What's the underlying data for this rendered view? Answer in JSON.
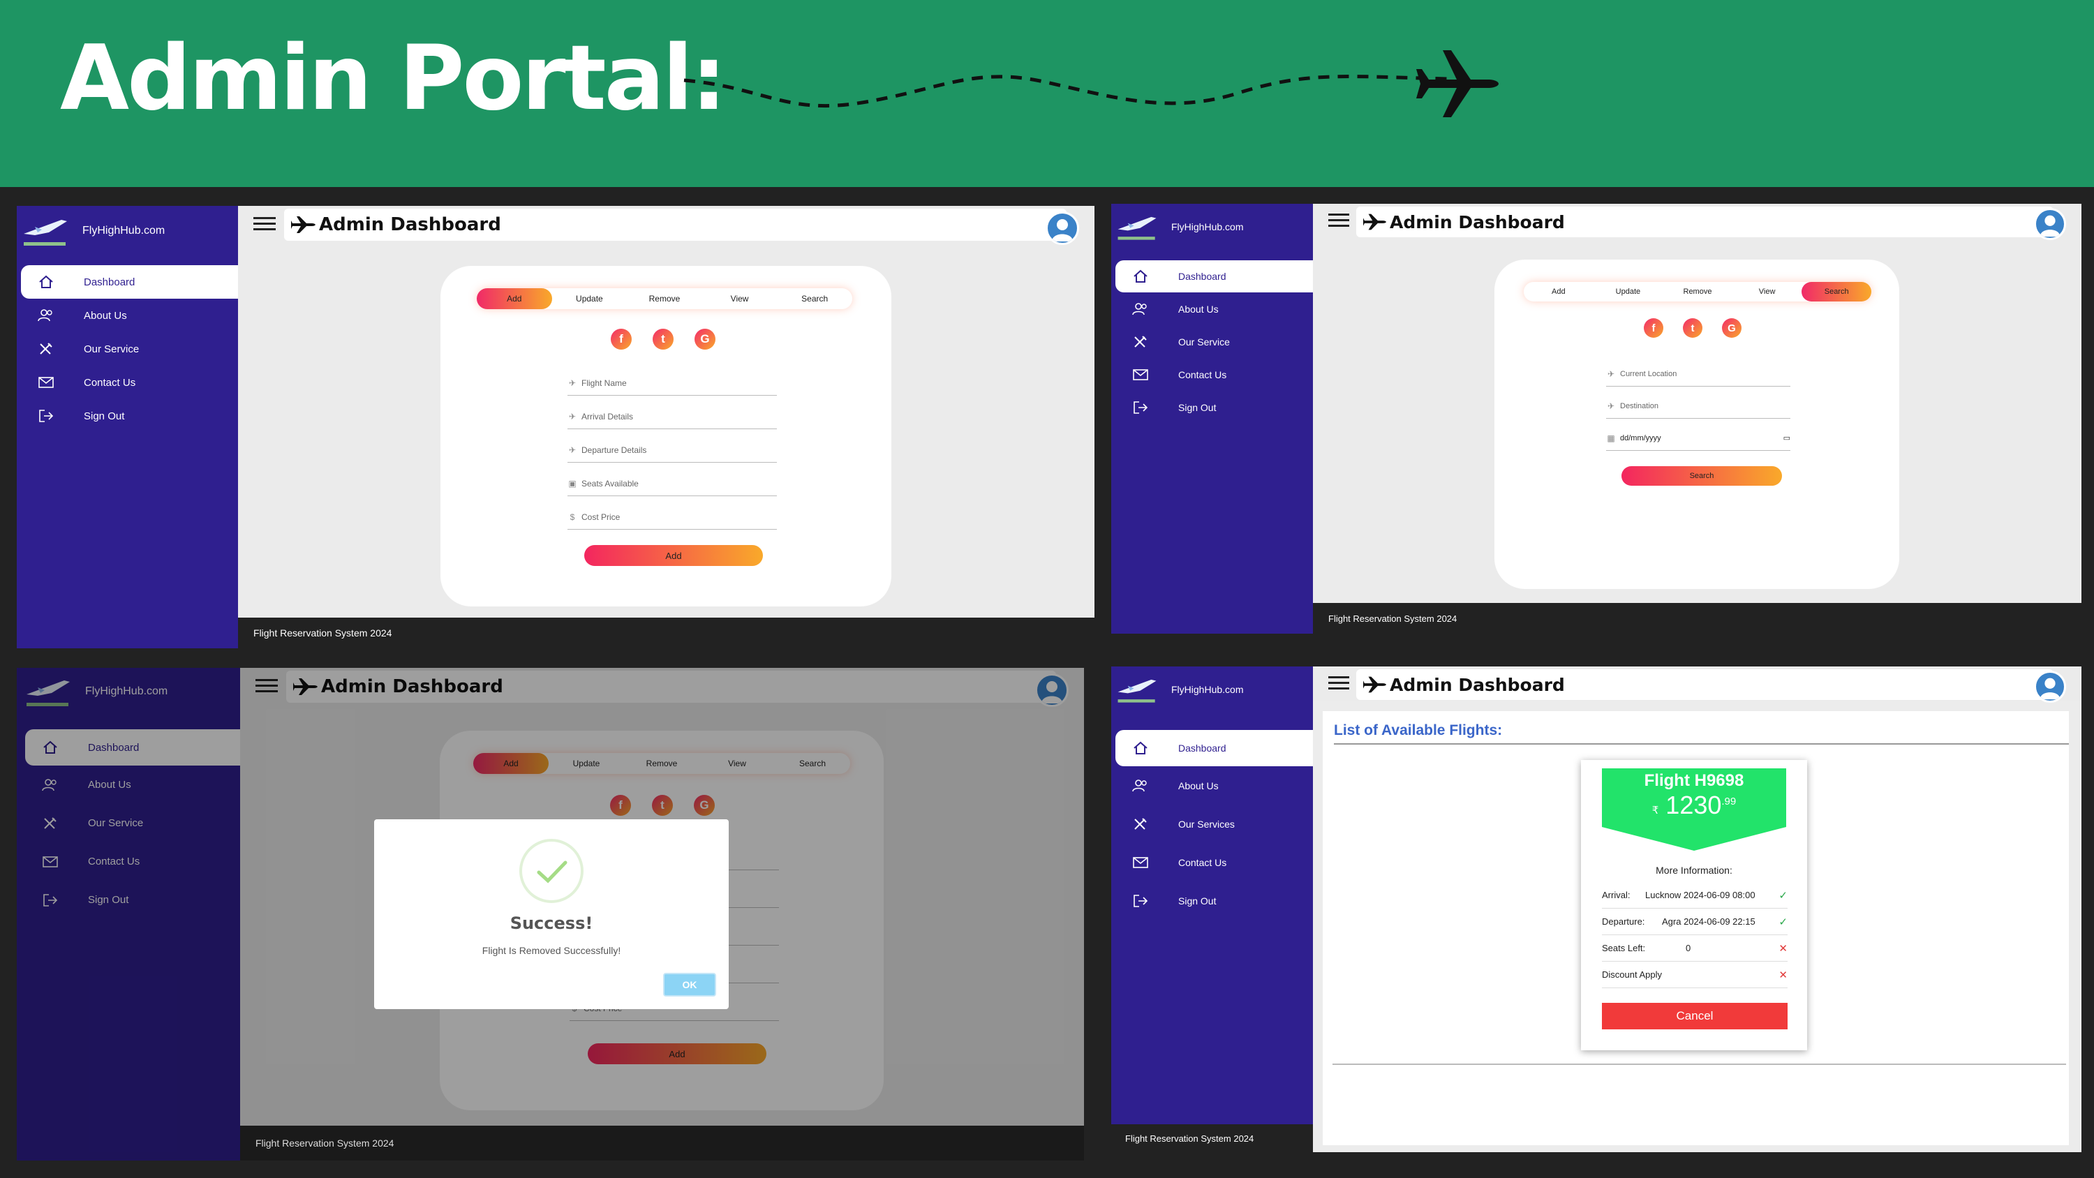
{
  "banner": {
    "title": "Admin Portal:",
    "background": "#1e9563"
  },
  "common": {
    "brand": "FlyHighHub.com",
    "dashboard_title": "Admin Dashboard",
    "footer": "Flight Reservation System 2024"
  },
  "sidebar": {
    "items": [
      {
        "label": "Dashboard",
        "icon": "home-icon"
      },
      {
        "label": "About Us",
        "icon": "users-icon"
      },
      {
        "label": "Our Service",
        "icon": "tools-icon"
      },
      {
        "label": "Contact Us",
        "icon": "mail-icon"
      },
      {
        "label": "Sign Out",
        "icon": "sign-out-icon"
      }
    ],
    "services_alt": "Our Services"
  },
  "tabs": [
    "Add",
    "Update",
    "Remove",
    "View",
    "Search"
  ],
  "add_form": {
    "fields": [
      "Flight Name",
      "Arrival Details",
      "Departure Details",
      "Seats Available",
      "Cost Price"
    ],
    "button": "Add"
  },
  "search_form": {
    "fields": [
      "Current Location",
      "Destination",
      "dd/mm/yyyy"
    ],
    "button": "Search"
  },
  "modal": {
    "title": "Success!",
    "message": "Flight Is Removed Successfully!",
    "ok": "OK"
  },
  "flights": {
    "heading": "List of Available Flights:",
    "flight_name": "Flight H9698",
    "currency": "₹",
    "price_main": "1230",
    "price_cents": ".99",
    "more_info": "More Information:",
    "rows": [
      {
        "label": "Arrival:",
        "value": "Lucknow 2024-06-09 08:00",
        "status": "✓"
      },
      {
        "label": "Departure:",
        "value": "Agra 2024-06-09 22:15",
        "status": "✓"
      },
      {
        "label": "Seats Left:",
        "value": "0",
        "status": "✕"
      },
      {
        "label": "Discount Apply",
        "value": "",
        "status": "✕"
      }
    ],
    "cancel": "Cancel"
  },
  "colors": {
    "sidebar": "#2f1f8f",
    "gradient_start": "#f02a68",
    "gradient_end": "#f9a92a",
    "flight_ribbon": "#22e36a",
    "cancel": "#f13a3a",
    "heading_blue": "#3b66c9"
  }
}
